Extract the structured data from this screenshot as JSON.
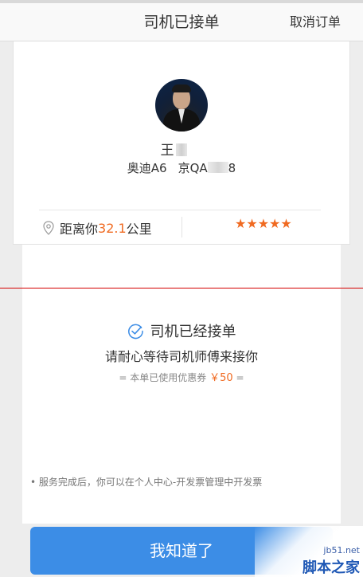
{
  "header": {
    "title": "司机已接单",
    "cancel_label": "取消订单"
  },
  "driver": {
    "name": "王",
    "car_model": "奥迪A6",
    "plate_start": "京QA",
    "plate_end": "8",
    "distance_prefix": "距离你",
    "distance_value": "32.1",
    "distance_unit": "公里",
    "rating": 5,
    "stars": "★★★★★"
  },
  "status": {
    "title": "司机已经接单",
    "subtitle": "请耐心等待司机师傅来接你",
    "coupon_prefix": "= 本单已使用优惠券",
    "coupon_amount": "￥50",
    "coupon_suffix": "=",
    "notice": "• 服务完成后，你可以在个人中心-开发票管理中开发票"
  },
  "actions": {
    "confirm_label": "我知道了"
  },
  "watermark": {
    "url": "jb51.net",
    "site": "脚本之家"
  },
  "colors": {
    "accent_orange": "#f06a21",
    "primary_blue": "#3c8de6"
  }
}
